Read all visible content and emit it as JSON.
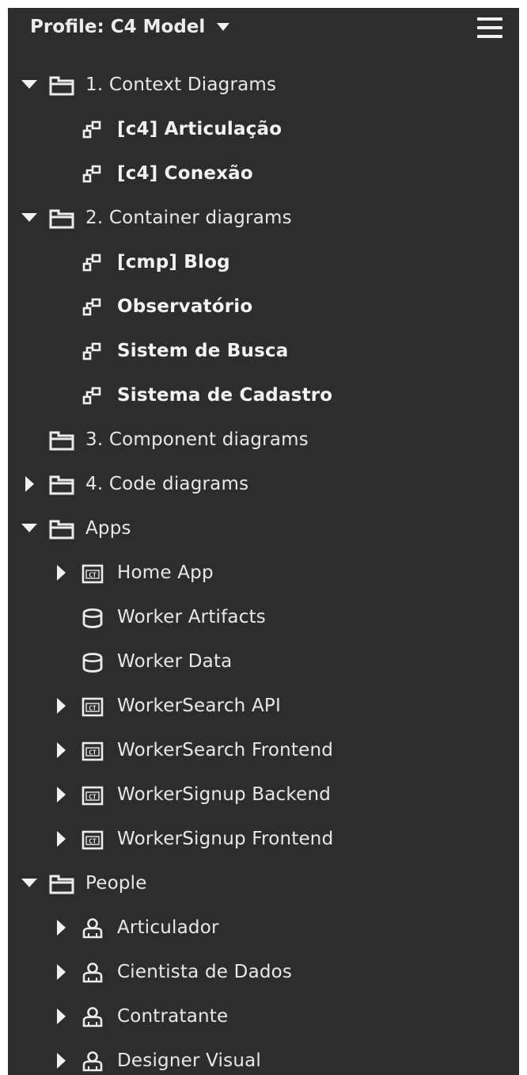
{
  "header": {
    "profile_label": "Profile: C4 Model"
  },
  "tree": [
    {
      "level": 0,
      "toggle": "expanded",
      "icon": "folder-icon",
      "label": "1. Context Diagrams",
      "bold": false
    },
    {
      "level": 1,
      "toggle": "none",
      "icon": "diagram-icon",
      "label": "[c4] Articulação",
      "bold": true
    },
    {
      "level": 1,
      "toggle": "none",
      "icon": "diagram-icon",
      "label": "[c4] Conexão",
      "bold": true
    },
    {
      "level": 0,
      "toggle": "expanded",
      "icon": "folder-icon",
      "label": "2. Container diagrams",
      "bold": false
    },
    {
      "level": 1,
      "toggle": "none",
      "icon": "diagram-icon",
      "label": "[cmp] Blog",
      "bold": true
    },
    {
      "level": 1,
      "toggle": "none",
      "icon": "diagram-icon",
      "label": "Observatório",
      "bold": true
    },
    {
      "level": 1,
      "toggle": "none",
      "icon": "diagram-icon",
      "label": "Sistem de Busca",
      "bold": true
    },
    {
      "level": 1,
      "toggle": "none",
      "icon": "diagram-icon",
      "label": "Sistema de Cadastro",
      "bold": true
    },
    {
      "level": 0,
      "toggle": "none",
      "icon": "folder-icon",
      "label": "3. Component diagrams",
      "bold": false
    },
    {
      "level": 0,
      "toggle": "collapsed",
      "icon": "folder-icon",
      "label": "4. Code diagrams",
      "bold": false
    },
    {
      "level": 0,
      "toggle": "expanded",
      "icon": "folder-icon",
      "label": "Apps",
      "bold": false
    },
    {
      "level": 1,
      "toggle": "collapsed",
      "icon": "container-icon",
      "label": "Home App",
      "bold": false
    },
    {
      "level": 1,
      "toggle": "none",
      "icon": "database-icon",
      "label": "Worker Artifacts",
      "bold": false
    },
    {
      "level": 1,
      "toggle": "none",
      "icon": "database-icon",
      "label": "Worker Data",
      "bold": false
    },
    {
      "level": 1,
      "toggle": "collapsed",
      "icon": "container-icon",
      "label": "WorkerSearch API",
      "bold": false
    },
    {
      "level": 1,
      "toggle": "collapsed",
      "icon": "container-icon",
      "label": "WorkerSearch Frontend",
      "bold": false
    },
    {
      "level": 1,
      "toggle": "collapsed",
      "icon": "container-icon",
      "label": "WorkerSignup Backend",
      "bold": false
    },
    {
      "level": 1,
      "toggle": "collapsed",
      "icon": "container-icon",
      "label": "WorkerSignup Frontend",
      "bold": false
    },
    {
      "level": 0,
      "toggle": "expanded",
      "icon": "folder-icon",
      "label": "People",
      "bold": false
    },
    {
      "level": 1,
      "toggle": "collapsed",
      "icon": "person-icon",
      "label": "Articulador",
      "bold": false
    },
    {
      "level": 1,
      "toggle": "collapsed",
      "icon": "person-icon",
      "label": "Cientista de Dados",
      "bold": false
    },
    {
      "level": 1,
      "toggle": "collapsed",
      "icon": "person-icon",
      "label": "Contratante",
      "bold": false
    },
    {
      "level": 1,
      "toggle": "collapsed",
      "icon": "person-icon",
      "label": "Designer Visual",
      "bold": false
    }
  ]
}
